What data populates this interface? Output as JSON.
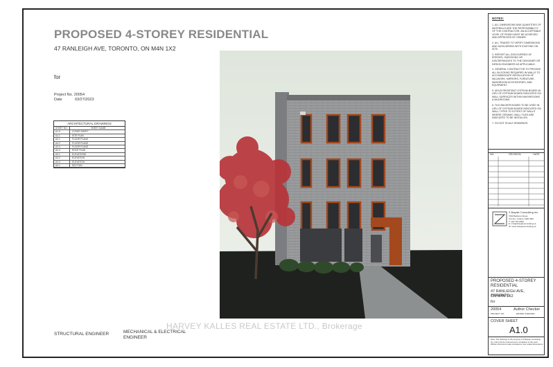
{
  "header": {
    "title": "PROPOSED 4-STOREY RESIDENTIAL",
    "address": "47 RANLEIGH AVE, TORONTO, ON M4N 1X2",
    "for_label": "for",
    "project_no": "Project No. 20054",
    "date_label": "Date",
    "date_value": "03/27/2023"
  },
  "drawings_table": {
    "title": "ARCHITECTURAL DRAWINGS",
    "col_sheet": "SHEET NO.",
    "col_name": "SHEET NAME",
    "rows": [
      {
        "no": "A1.0",
        "name": "COVER SHEET"
      },
      {
        "no": "A1.1",
        "name": "SITE PLAN"
      },
      {
        "no": "A2.1",
        "name": "FLOOR PLANS"
      },
      {
        "no": "A2.2",
        "name": "FLOOR PLANS"
      },
      {
        "no": "A2.3",
        "name": "FLOOR PLANS"
      },
      {
        "no": "A2.4",
        "name": "ROOF PLAN"
      },
      {
        "no": "A3.1",
        "name": "ELEVATIONS"
      },
      {
        "no": "A3.2",
        "name": "ELEVATION"
      },
      {
        "no": "A3.3",
        "name": "ELEVATION"
      },
      {
        "no": "A4.1",
        "name": "SECTION"
      }
    ]
  },
  "watermark": "HARVEY KALLES REAL ESTATE LTD., Brokerage",
  "engineers": {
    "structural": "STRUCTURAL ENGINEER",
    "mech_line1": "MECHANICAL & ELECTRICAL",
    "mech_line2": "ENGINEER"
  },
  "title_block": {
    "notes_title": "NOTES:",
    "notes": [
      "1. ALL DIMENSIONS AND QUANTITIES OF MATERIALS ARE THE RESPONSIBILITY OF THE CONTRACTOR. AN ACCEPTABLE LEVEL OF FINISH MUST BE ACHIEVED AND APPROVED BY OWNER.",
      "2. ALL TRADES TO VERIFY DIMENSIONS AND DATA HEREIN WITH EXISTING ON SITE.",
      "3. REPORT ALL DISCOVERIES OF ERRORS, OMISSIONS OR DISCREPANCIES TO THE DESIGNER OR DESIGN ENGINEER AS APPLICABLE.",
      "4. GENERAL CONTRACTOR TO PROVIDE ALL BLOCKING REQUIRED IN WALLS TO ACCOMMODATE INSTALLATION OF MILLWORK, MIRRORS, FURNITURE, WASHROOM ACCESSORIES, AND EQUIPMENT.",
      "5. MOLD RESISTANT GYPSUM BOARD IN LIEU OF GYPSUM BOARD INDICATED ON WALL SURFACES WITHIN WASHROOMS & MUDROOMS.",
      "6. TILE BACKER BOARD TO BE USED IN LIEU OF GYPSUM BOARD INDICATED ON WALL TYPES TO EXTENT OF WALLS WHERE CERAMIC WALL TILES ARE INDICATED TO BE INSTALLED.",
      "7. DO NOT SCALE DRAWINGS."
    ],
    "revisions_header": "",
    "rev_cols": [
      "NO.",
      "REVISION",
      "DATE"
    ],
    "firm_name": "Z Bayaie Consulting Inc.",
    "firm_lines": [
      "7000 Bathurst Street",
      "Toronto, Ontario, M2R 3R9",
      "T: 416-787-9090",
      "E: info@zbayaieconsulting.ca",
      "W: www.zbayaieconsulting.ca"
    ],
    "project_title_1": "PROPOSED 4-STOREY",
    "project_title_2": "RESIDENTIAL",
    "project_addr_1": "47 RANLEIGH AVE, TORONTO,",
    "project_addr_2": "ON M4N 1X2",
    "project_for": "for",
    "job_no": "20054",
    "checker": "Author Checker",
    "job_sub": "PROJECT NO.",
    "date_sub": "DRAWN  CHECKED",
    "sheet_title": "COVER SHEET",
    "sheet_no": "A1.0",
    "footer_note": "Note: The drawings of the property of Z Bayaie Consulting Inc. and must be returned upon completion of the work. Written dimensions take precedence over scaled dimensions."
  }
}
